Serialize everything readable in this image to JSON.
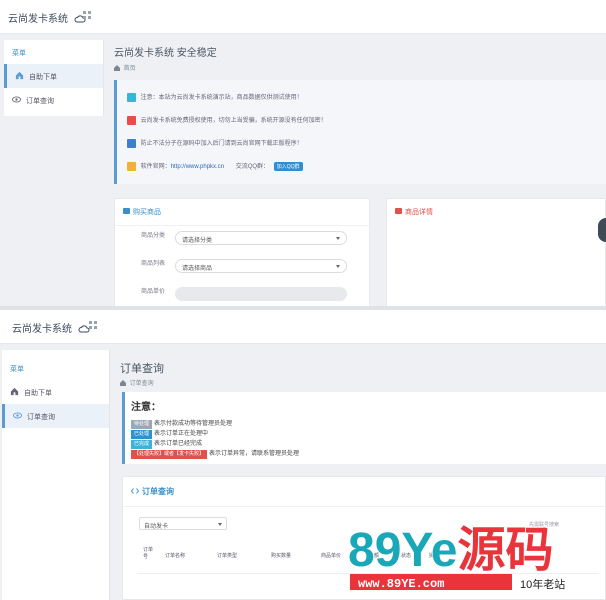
{
  "app": {
    "brand": "云尚发卡系统"
  },
  "screen1": {
    "sidebar": {
      "head": "菜单",
      "items": [
        {
          "label": "自助下单",
          "active": true
        },
        {
          "label": "订单查询",
          "active": false
        }
      ]
    },
    "title": "云尚发卡系统 安全稳定",
    "breadcrumb": "首页",
    "notices": [
      {
        "text": "注意：本站为云尚发卡系统演示站，商品数据仅供测试使用！",
        "badge_color": "#3cb4d8"
      },
      {
        "text": "云尚发卡系统免费授权使用，切勿上当受骗，系统开源没有任何加密！",
        "badge_color": "#e0514a"
      },
      {
        "text": "防止不法分子在源码中加入后门请到云尚官网下载正版程序！",
        "badge_color": "#3b7fd0"
      },
      {
        "text_prefix": "软件官网：",
        "link": "http://www.phpkx.cn",
        "qq_label": "交流QQ群：",
        "qq_button": "加入QQ群",
        "badge_color": "#f2b134"
      }
    ],
    "buy_panel": {
      "title": "购买商品",
      "fields": [
        {
          "label": "商品分类",
          "value": "请选择分类"
        },
        {
          "label": "商品列表",
          "value": "请选择商品"
        },
        {
          "label": "商品单价",
          "value": ""
        }
      ]
    },
    "detail_panel": {
      "title": "商品详情"
    }
  },
  "screen2": {
    "sidebar": {
      "head": "菜单",
      "items": [
        {
          "label": "自助下单",
          "active": false
        },
        {
          "label": "订单查询",
          "active": true
        }
      ]
    },
    "title": "订单查询",
    "breadcrumb": "订单查询",
    "notice": {
      "title": "注意：",
      "rows": [
        {
          "tag": "待处理",
          "tag_color": "#9aa7b5",
          "text": "表示付款成功等待管理员处理"
        },
        {
          "tag": "已处理",
          "tag_color": "#2c93d3",
          "text": "表示订单正在处理中"
        },
        {
          "tag": "已完成",
          "tag_color": "#3cb4d8",
          "text": "表示订单已经完成"
        },
        {
          "tag": "【处理失败】或者【发卡失败】",
          "tag_color": "#e0514a",
          "text": "表示订单异常，请联系管理员处理"
        }
      ]
    },
    "query_panel": {
      "title": "订单查询",
      "select_value": "自动发卡",
      "hint": "先需联号搜索",
      "columns": [
        "订单号",
        "订单名称",
        "订单类型",
        "购买数量",
        "商品单价",
        "金额",
        "状态",
        "操作"
      ]
    }
  },
  "watermark": {
    "logo": "89Ye源码",
    "site": "www.89YE.com",
    "slogan": "10年老站"
  },
  "colors": {
    "accent": "#5b9bd1",
    "link": "#2a6ebb",
    "logo_red": "#e8343a",
    "logo_teal": "#1aa7b8"
  }
}
